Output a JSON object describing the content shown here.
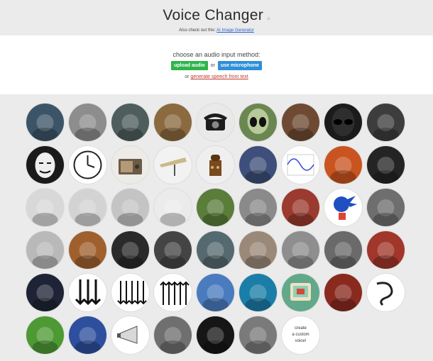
{
  "header": {
    "title": "Voice Changer",
    "title_badge": "ai",
    "subtitle_prefix": "Also check out this:",
    "subtitle_link": "AI Image Generator"
  },
  "input": {
    "prompt": "choose an audio input method:",
    "upload_label": "upload audio",
    "or_label": "or",
    "mic_label": "use microphone",
    "tts_prefix": "or",
    "tts_link": "generate speech from text"
  },
  "voices": [
    {
      "icon": "sea-creature-icon",
      "bg": "#3c5468"
    },
    {
      "icon": "gramophone-icon",
      "bg": "#8d8d8d"
    },
    {
      "icon": "ghost-hand-icon",
      "bg": "#4e5e5c"
    },
    {
      "icon": "church-interior-icon",
      "bg": "#8a6a3e"
    },
    {
      "icon": "telephone-icon",
      "bg": "#e9e9e9"
    },
    {
      "icon": "alien-icon",
      "bg": "#6b8751"
    },
    {
      "icon": "melting-clock-icon",
      "bg": "#6e4a32"
    },
    {
      "icon": "dark-alien-icon",
      "bg": "#1b1b1b"
    },
    {
      "icon": "dark-robot-icon",
      "bg": "#3d3d3d"
    },
    {
      "icon": "anonymous-mask-icon",
      "bg": "#1a1a1a"
    },
    {
      "icon": "wall-clock-icon",
      "bg": "#ffffff"
    },
    {
      "icon": "radio-icon",
      "bg": "#ecebe8"
    },
    {
      "icon": "spaceship-icon",
      "bg": "#f2f2f2"
    },
    {
      "icon": "dalek-icon",
      "bg": "#efefef"
    },
    {
      "icon": "synthesizer-icon",
      "bg": "#3d4f7a"
    },
    {
      "icon": "sine-wave-icon",
      "bg": "#ffffff"
    },
    {
      "icon": "fire-demon-icon",
      "bg": "#c9541f"
    },
    {
      "icon": "cave-icon",
      "bg": "#242424"
    },
    {
      "icon": "robot-figure-icon",
      "bg": "#d8d8d8"
    },
    {
      "icon": "robot-toy-icon",
      "bg": "#d3d3d3"
    },
    {
      "icon": "tin-robot-icon",
      "bg": "#c4c4c4"
    },
    {
      "icon": "boxing-robot-icon",
      "bg": "#ebebeb"
    },
    {
      "icon": "snail-icon",
      "bg": "#5a7d3a"
    },
    {
      "icon": "tortoise-icon",
      "bg": "#8a8a8a"
    },
    {
      "icon": "runner-icon",
      "bg": "#9b3a2e"
    },
    {
      "icon": "sonic-icon",
      "bg": "#ffffff"
    },
    {
      "icon": "old-man-icon",
      "bg": "#6e6e6e"
    },
    {
      "icon": "hand-phone-icon",
      "bg": "#b9b9b9"
    },
    {
      "icon": "wooden-box-icon",
      "bg": "#a0602e"
    },
    {
      "icon": "speaker-man-icon",
      "bg": "#2a2a2a"
    },
    {
      "icon": "witch-king-icon",
      "bg": "#444444"
    },
    {
      "icon": "soldier-icon",
      "bg": "#556a70"
    },
    {
      "icon": "wtf-meme-icon",
      "bg": "#9a8878"
    },
    {
      "icon": "small-robot-icon",
      "bg": "#8e8e8e"
    },
    {
      "icon": "cute-robot-icon",
      "bg": "#6a6a6a"
    },
    {
      "icon": "angry-face-icon",
      "bg": "#a1362a"
    },
    {
      "icon": "astronaut-icon",
      "bg": "#1e2436"
    },
    {
      "icon": "arrows-down-icon",
      "bg": "#ffffff"
    },
    {
      "icon": "arrows-down-small-icon",
      "bg": "#ffffff"
    },
    {
      "icon": "arrows-up-icon",
      "bg": "#ffffff"
    },
    {
      "icon": "chipmunks-icon",
      "bg": "#4a7bbf"
    },
    {
      "icon": "diver-icon",
      "bg": "#1a7ea8"
    },
    {
      "icon": "retro-computer-icon",
      "bg": "#62a88a"
    },
    {
      "icon": "red-robot-icon",
      "bg": "#8a2a1e"
    },
    {
      "icon": "phone-cord-icon",
      "bg": "#ffffff"
    },
    {
      "icon": "mosquito-icon",
      "bg": "#4d9a34"
    },
    {
      "icon": "mech-robot-icon",
      "bg": "#2d4f9e"
    },
    {
      "icon": "megaphone-icon",
      "bg": "#ffffff"
    },
    {
      "icon": "bane-icon",
      "bg": "#6f6f6f"
    },
    {
      "icon": "black-surface-icon",
      "bg": "#161616"
    },
    {
      "icon": "metal-icon",
      "bg": "#7a7a7a"
    }
  ],
  "custom_voice": {
    "line1": "create",
    "line2": "a custom",
    "line3": "voice!"
  }
}
